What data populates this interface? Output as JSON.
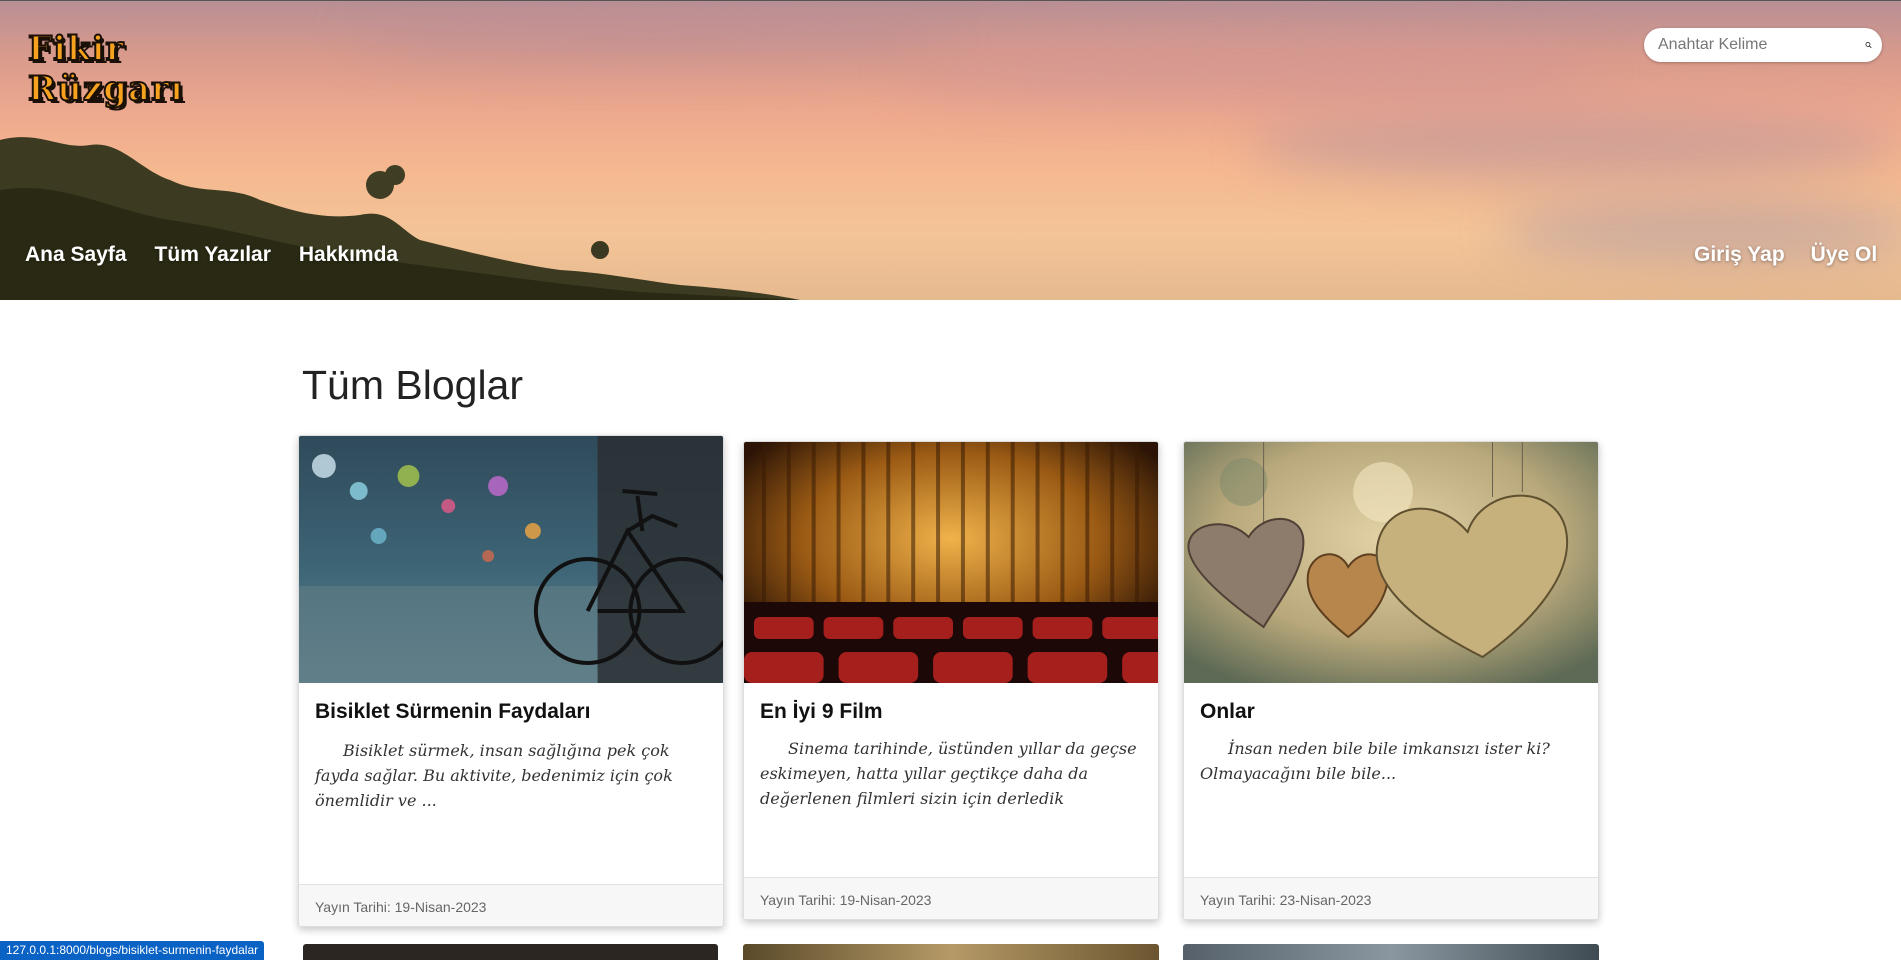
{
  "header": {
    "logo_line1": "Fikir",
    "logo_line2": "Rüzgarı",
    "search_placeholder": "Anahtar Kelime",
    "nav_left": [
      "Ana Sayfa",
      "Tüm Yazılar",
      "Hakkımda"
    ],
    "nav_right": [
      "Giriş Yap",
      "Üye Ol"
    ]
  },
  "main": {
    "title": "Tüm Bloglar",
    "posts": [
      {
        "title": "Bisiklet Sürmenin Faydaları",
        "excerpt": "Bisiklet sürmek, insan sağlığına pek çok fayda sağlar. Bu aktivite, bedenimiz için çok önemlidir ve ...",
        "date": "Yayın Tarihi: 19-Nisan-2023",
        "image": "bicycle-photo"
      },
      {
        "title": "En İyi 9 Film",
        "excerpt": "Sinema tarihinde, üstünden yıllar da geçse eskimeyen, hatta yıllar geçtikçe daha da değerlenen filmleri sizin için derledik",
        "date": "Yayın Tarihi: 19-Nisan-2023",
        "image": "cinema-curtain-photo"
      },
      {
        "title": "Onlar",
        "excerpt": "İnsan neden bile bile imkansızı ister ki? Olmayacağını bile bile...",
        "date": "Yayın Tarihi: 23-Nisan-2023",
        "image": "hanging-hearts-photo"
      }
    ]
  },
  "status_bar": {
    "url": "127.0.0.1:8000/blogs/bisiklet-surmenin-faydalar"
  }
}
